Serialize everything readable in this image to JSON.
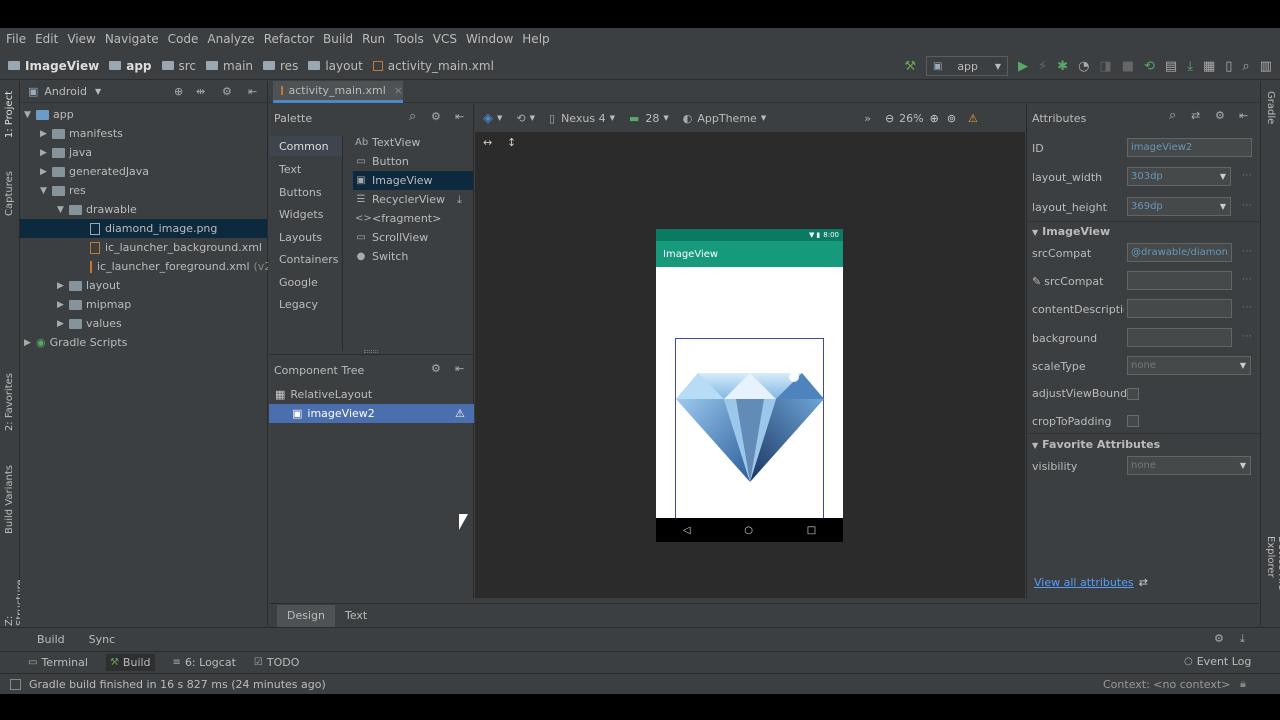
{
  "menu": [
    "File",
    "Edit",
    "View",
    "Navigate",
    "Code",
    "Analyze",
    "Refactor",
    "Build",
    "Run",
    "Tools",
    "VCS",
    "Window",
    "Help"
  ],
  "breadcrumbs": [
    "ImageView",
    "app",
    "src",
    "main",
    "res",
    "layout",
    "activity_main.xml"
  ],
  "run_config": "app",
  "left_strip": {
    "project": "1: Project",
    "captures": "Captures",
    "favorites": "2: Favorites",
    "build_variants": "Build Variants",
    "structure": "Z: Structure"
  },
  "right_strip": {
    "gradle": "Gradle",
    "device_file_explorer": "Device File Explorer"
  },
  "project": {
    "view_mode": "Android",
    "tree": [
      {
        "label": "app",
        "level": 0
      },
      {
        "label": "manifests",
        "level": 1
      },
      {
        "label": "java",
        "level": 1
      },
      {
        "label": "generatedJava",
        "level": 1
      },
      {
        "label": "res",
        "level": 1
      },
      {
        "label": "drawable",
        "level": 2
      },
      {
        "label": "diamond_image.png",
        "level": 3
      },
      {
        "label": "ic_launcher_background.xml",
        "level": 3
      },
      {
        "label": "ic_launcher_foreground.xml",
        "suffix": "(v24",
        "level": 3
      },
      {
        "label": "layout",
        "level": 2
      },
      {
        "label": "mipmap",
        "level": 2
      },
      {
        "label": "values",
        "level": 2
      },
      {
        "label": "Gradle Scripts",
        "level": 0
      }
    ]
  },
  "editor_tab": "activity_main.xml",
  "palette": {
    "title": "Palette",
    "categories": [
      "Common",
      "Text",
      "Buttons",
      "Widgets",
      "Layouts",
      "Containers",
      "Google",
      "Legacy"
    ],
    "items": [
      {
        "icon": "Ab",
        "label": "TextView"
      },
      {
        "icon": "▭",
        "label": "Button"
      },
      {
        "icon": "▣",
        "label": "ImageView"
      },
      {
        "icon": "☰",
        "label": "RecyclerView"
      },
      {
        "icon": "<>",
        "label": "<fragment>"
      },
      {
        "icon": "▭",
        "label": "ScrollView"
      },
      {
        "icon": "●",
        "label": "Switch"
      }
    ]
  },
  "component_tree": {
    "title": "Component Tree",
    "items": [
      "RelativeLayout",
      "imageView2"
    ]
  },
  "design_toolbar": {
    "device": "Nexus 4",
    "api": "28",
    "theme": "AppTheme",
    "zoom": "26%"
  },
  "phone": {
    "status_time": "8:00",
    "app_title": "ImageView"
  },
  "attributes": {
    "title": "Attributes",
    "id_label": "ID",
    "id_value": "imageView2",
    "layout_width_label": "layout_width",
    "layout_width": "303dp",
    "layout_height_label": "layout_height",
    "layout_height": "369dp",
    "section_imageview": "ImageView",
    "srcCompat_label": "srcCompat",
    "srcCompat_value": "@drawable/diamon",
    "srcCompat2_label": "srcCompat",
    "contentDescription_label": "contentDescriptio",
    "background_label": "background",
    "scaleType_label": "scaleType",
    "scaleType_value": "none",
    "adjustViewBounds_label": "adjustViewBound:",
    "cropToPadding_label": "cropToPadding",
    "section_favorite": "Favorite Attributes",
    "visibility_label": "visibility",
    "visibility_value": "none",
    "view_all": "View all attributes"
  },
  "bottom_tabs": [
    "Design",
    "Text"
  ],
  "build_bar": [
    "Build",
    "Sync"
  ],
  "tool_windows": [
    "Terminal",
    "Build",
    "6: Logcat",
    "TODO"
  ],
  "event_log": "Event Log",
  "status_message": "Gradle build finished in 16 s 827 ms (24 minutes ago)",
  "context": "Context: <no context>"
}
